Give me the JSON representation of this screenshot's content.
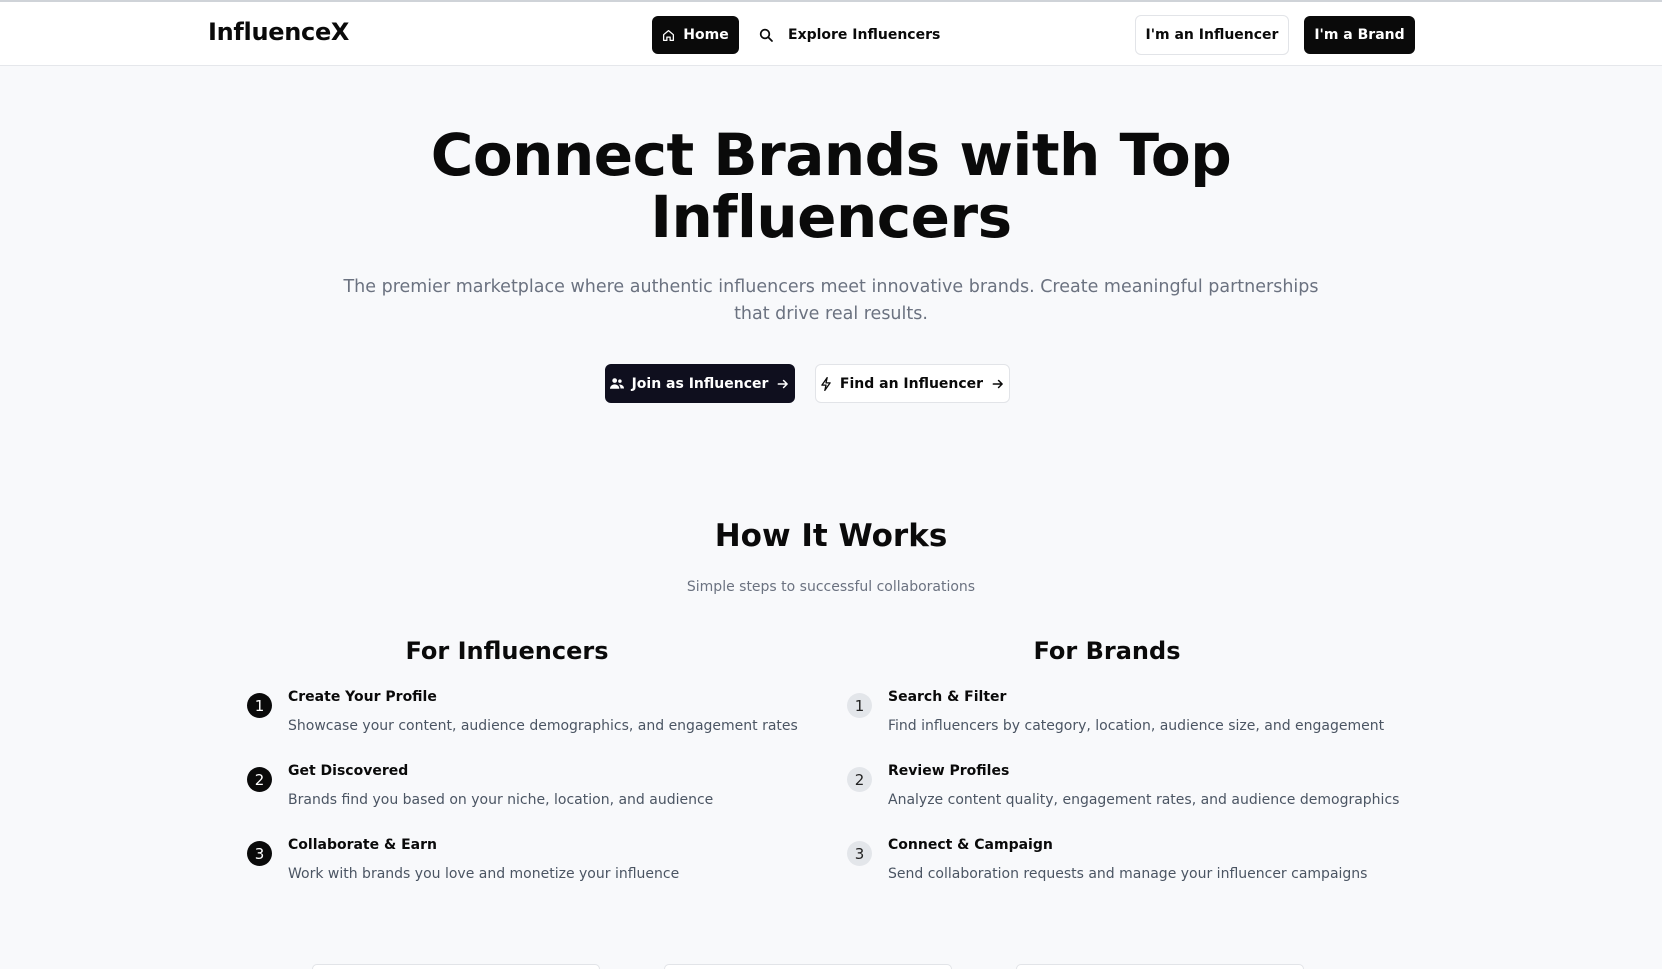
{
  "header": {
    "logo": "InfluenceX",
    "nav": {
      "home_label": "Home",
      "home_icon": "home-icon",
      "explore_label": "Explore Influencers",
      "explore_icon": "search-icon"
    },
    "influencer_button": "I'm an Influencer",
    "brand_button": "I'm a Brand"
  },
  "hero": {
    "title": "Connect Brands with Top Influencers",
    "subtitle": "The premier marketplace where authentic influencers meet innovative brands. Create meaningful partnerships that drive real results.",
    "join_button": {
      "label": "Join as Influencer",
      "icon": "users-icon",
      "arrow": "arrow-right-icon"
    },
    "find_button": {
      "label": "Find an Influencer",
      "icon": "zap-icon",
      "arrow": "arrow-right-icon"
    }
  },
  "how_it_works": {
    "title": "How It Works",
    "subtitle": "Simple steps to successful collaborations",
    "influencers": {
      "title": "For Influencers",
      "steps": [
        {
          "num": "1",
          "title": "Create Your Profile",
          "desc": "Showcase your content, audience demographics, and engagement rates"
        },
        {
          "num": "2",
          "title": "Get Discovered",
          "desc": "Brands find you based on your niche, location, and audience"
        },
        {
          "num": "3",
          "title": "Collaborate & Earn",
          "desc": "Work with brands you love and monetize your influence"
        }
      ]
    },
    "brands": {
      "title": "For Brands",
      "steps": [
        {
          "num": "1",
          "title": "Search & Filter",
          "desc": "Find influencers by category, location, audience size, and engagement"
        },
        {
          "num": "2",
          "title": "Review Profiles",
          "desc": "Analyze content quality, engagement rates, and audience demographics"
        },
        {
          "num": "3",
          "title": "Connect & Campaign",
          "desc": "Send collaboration requests and manage your influencer campaigns"
        }
      ]
    }
  },
  "colors": {
    "primary": "#0a0a0a",
    "background": "#f8f9fb",
    "muted_text": "#6b7280",
    "step_badge_brand": "#e3e6ea"
  }
}
